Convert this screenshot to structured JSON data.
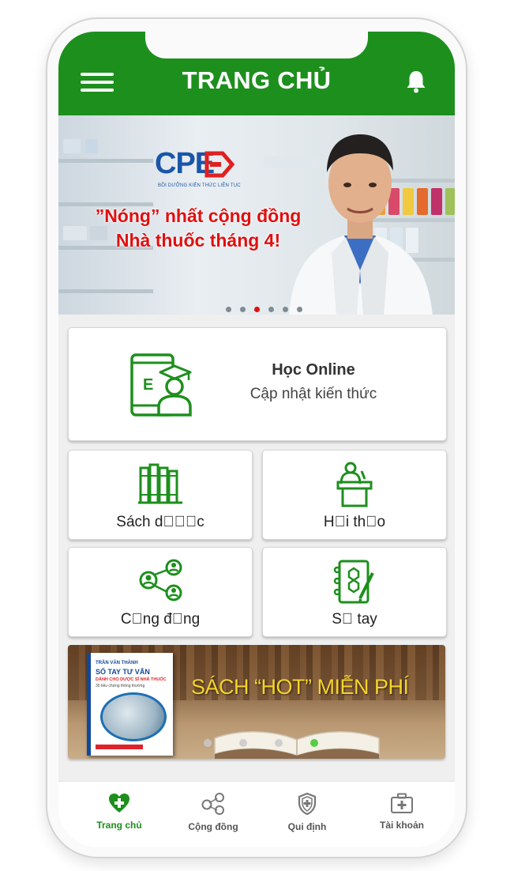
{
  "header": {
    "title": "TRANG CHỦ",
    "menu_icon": "hamburger-menu-icon",
    "notification_icon": "bell-icon"
  },
  "banner": {
    "logo": "CPE",
    "logo_tagline": "BỒI DƯỠNG KIẾN THỨC LIÊN TỤC",
    "headline_line1": "”Nóng” nhất cộng đồng",
    "headline_line2": "Nhà thuốc tháng 4!",
    "slide_count": 6,
    "active_slide": 3
  },
  "online_card": {
    "title": "Học Online",
    "subtitle": "Cập nhật kiến thức",
    "icon": "tablet-graduate-icon"
  },
  "tiles": [
    {
      "label": "Sách d\u0000\u0000\u0000c",
      "icon": "books-icon"
    },
    {
      "label": "H\u0000i th\u0000o",
      "icon": "podium-speaker-icon"
    },
    {
      "label": "C\u0000ng đ\u0000ng",
      "icon": "community-network-icon"
    },
    {
      "label": "S\u0000 tay",
      "icon": "notebook-icon"
    }
  ],
  "book_banner": {
    "title": "SÁCH “HOT” MIỄN PHÍ",
    "cover_small": "TRẦN VĂN THÀNH",
    "cover_title": "SỔ TAY TƯ VẤN",
    "cover_subtitle": "DÀNH CHO DƯỢC SĨ NHÀ THUỐC",
    "cover_note": "30 tiêu chứng thông thường",
    "slide_count": 4,
    "active_slide": 4
  },
  "tabbar": [
    {
      "label": "Trang chủ",
      "icon": "heart-plus-icon",
      "active": true
    },
    {
      "label": "Cộng đồng",
      "icon": "community-network-icon",
      "active": false
    },
    {
      "label": "Qui định",
      "icon": "shield-plus-icon",
      "active": false
    },
    {
      "label": "Tài khoản",
      "icon": "medical-bag-icon",
      "active": false
    }
  ],
  "colors": {
    "brand_green": "#1d8f1d",
    "accent_red": "#e01010",
    "banner_title_yellow": "#f5d42a"
  }
}
